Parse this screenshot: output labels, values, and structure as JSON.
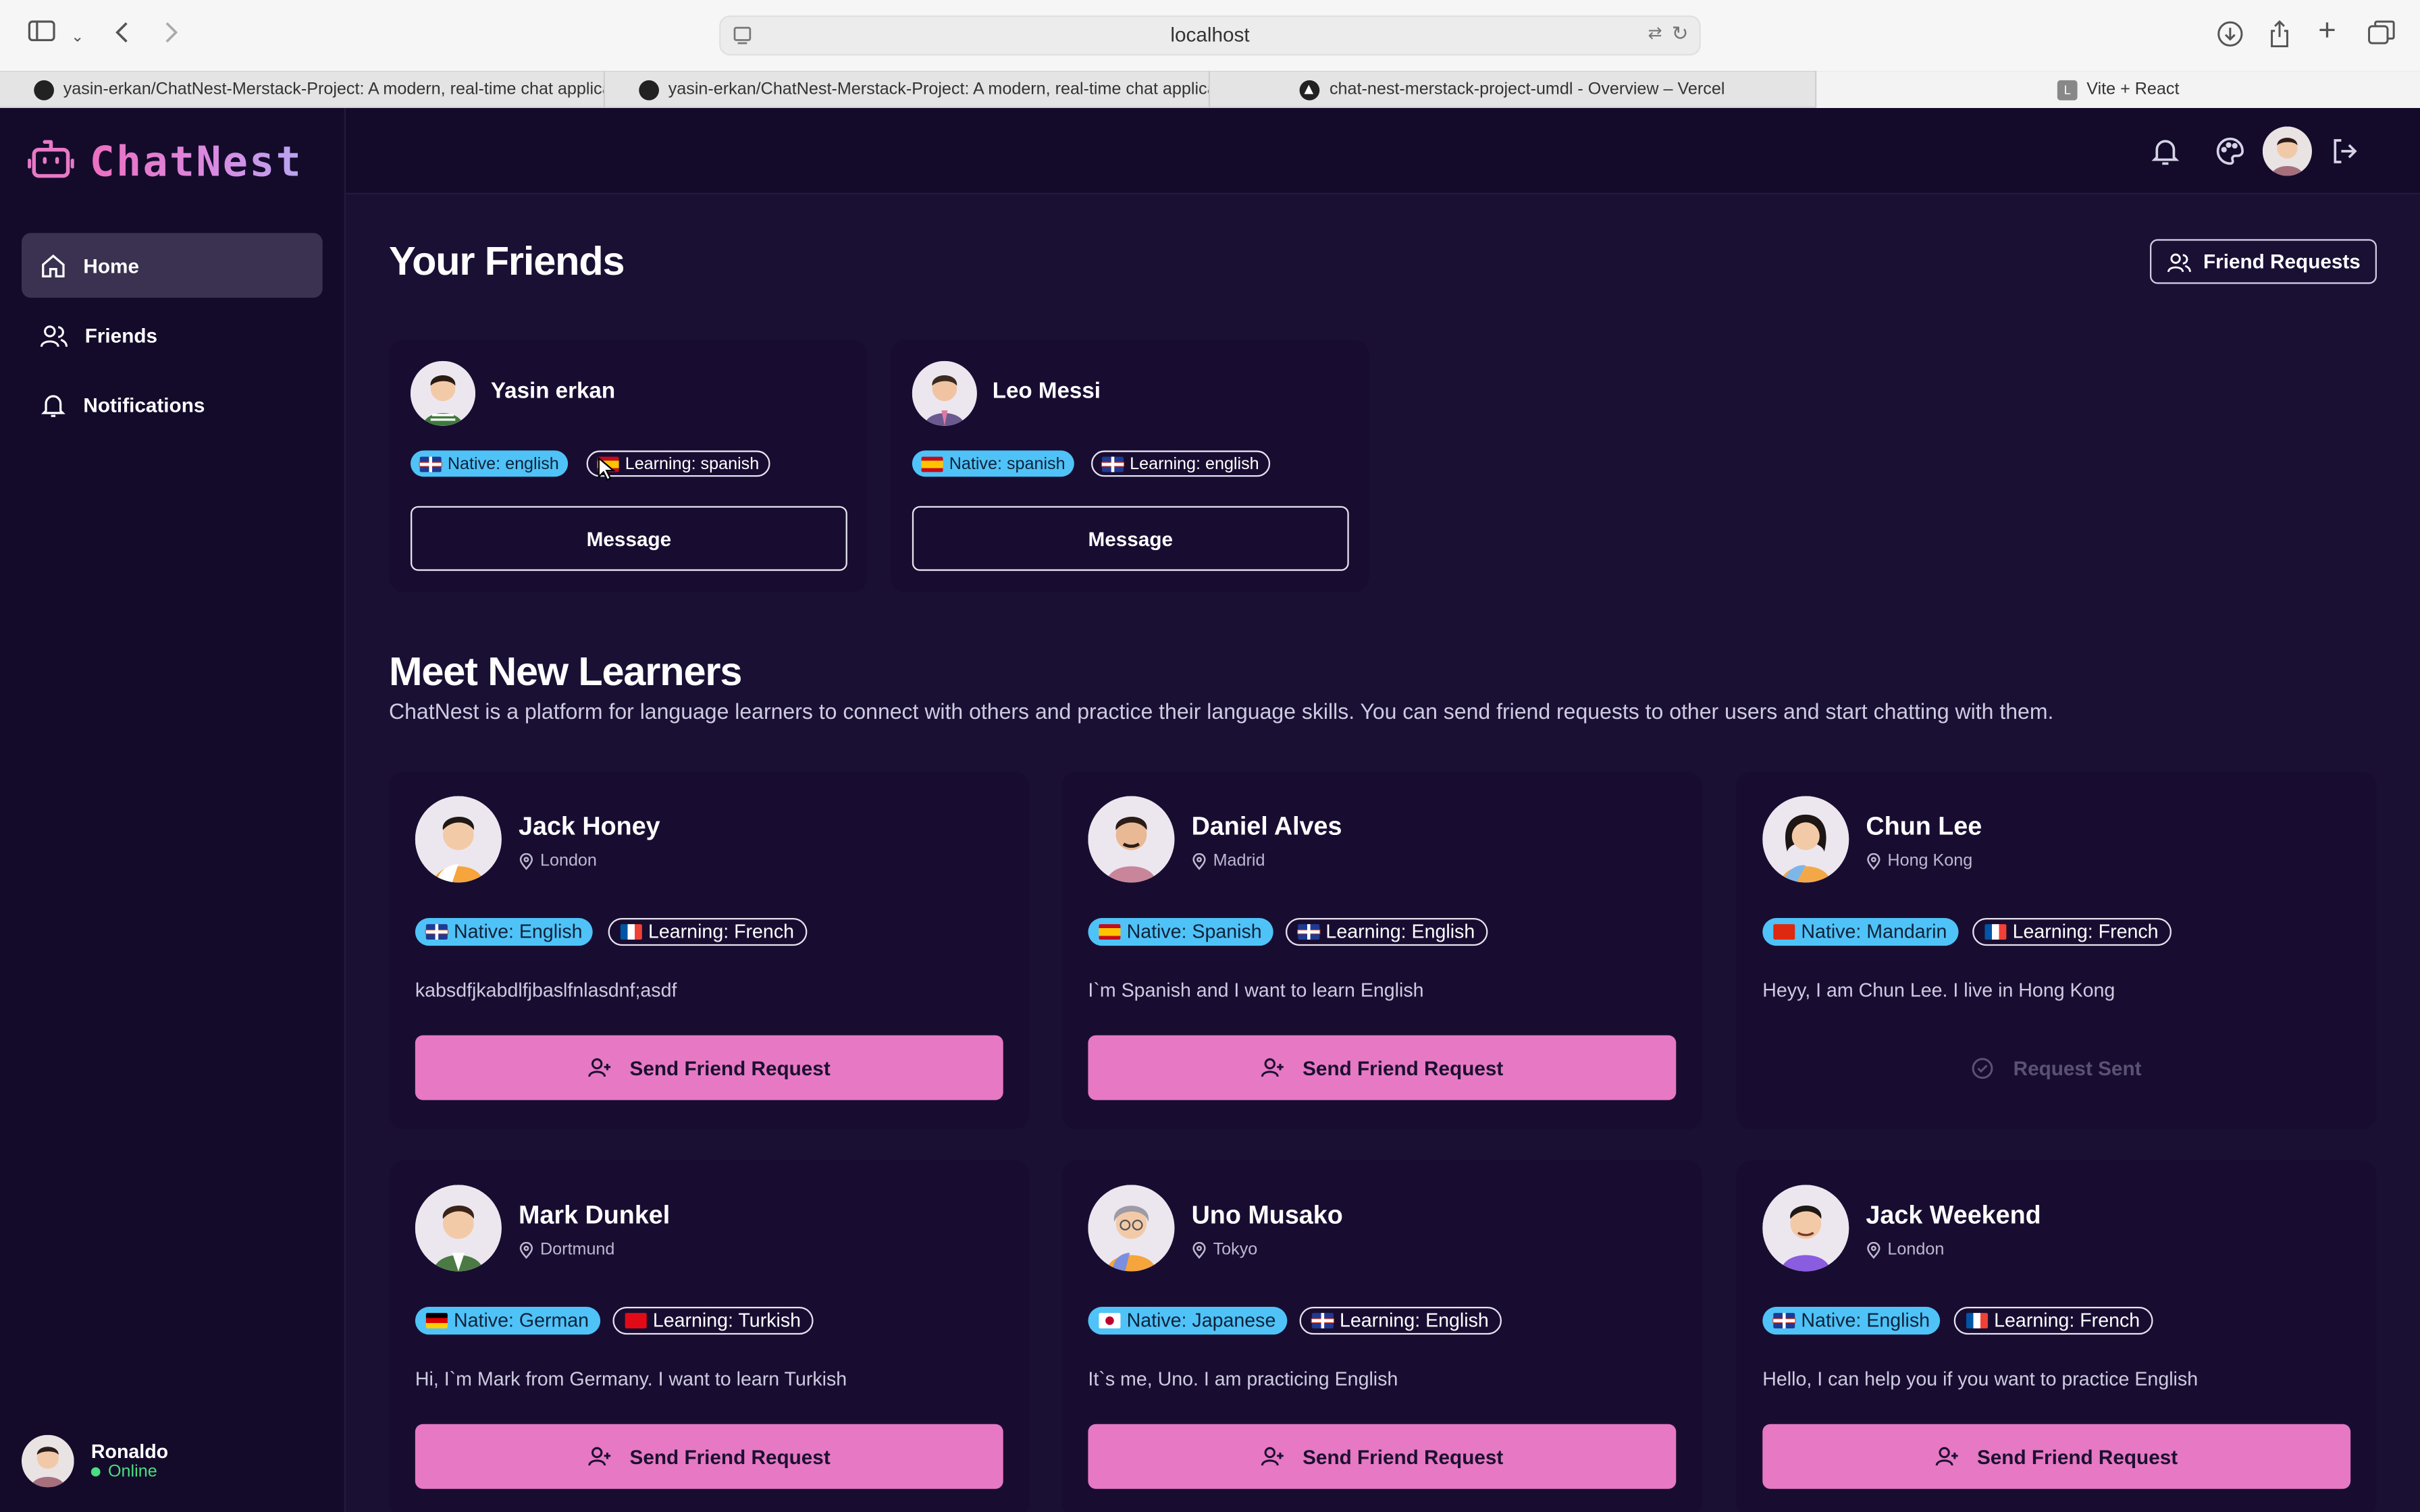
{
  "browser": {
    "url": "localhost",
    "tabs": [
      {
        "label": "yasin-erkan/ChatNest-Merstack-Project: A modern, real-time chat applicati..."
      },
      {
        "label": "yasin-erkan/ChatNest-Merstack-Project: A modern, real-time chat applicati..."
      },
      {
        "label": "chat-nest-merstack-project-umdl - Overview – Vercel"
      },
      {
        "label": "Vite + React"
      }
    ]
  },
  "app": {
    "brand": "ChatNest",
    "nav": [
      {
        "label": "Home",
        "icon": "home-icon"
      },
      {
        "label": "Friends",
        "icon": "users-icon"
      },
      {
        "label": "Notifications",
        "icon": "bell-icon"
      }
    ],
    "current_user": {
      "name": "Ronaldo",
      "status": "Online"
    }
  },
  "friends_section": {
    "title": "Your Friends",
    "requests_button": "Friend Requests",
    "friends": [
      {
        "name": "Yasin erkan",
        "native": "Native: english",
        "learning": "Learning: spanish",
        "action": "Message"
      },
      {
        "name": "Leo Messi",
        "native": "Native: spanish",
        "learning": "Learning: english",
        "action": "Message"
      }
    ]
  },
  "learners_section": {
    "title": "Meet New Learners",
    "description": "ChatNest is a platform for language learners to connect with others and practice their language skills. You can send friend requests to other users and start chatting with them.",
    "learners": [
      {
        "name": "Jack Honey",
        "location": "London",
        "native": "Native: English",
        "learning": "Learning: French",
        "bio": "kabsdfjkabdlfjbaslfnlasdnf;asdf",
        "action": "Send Friend Request"
      },
      {
        "name": "Daniel Alves",
        "location": "Madrid",
        "native": "Native: Spanish",
        "learning": "Learning: English",
        "bio": "I`m Spanish and I want to learn English",
        "action": "Send Friend Request"
      },
      {
        "name": "Chun Lee",
        "location": "Hong Kong",
        "native": "Native: Mandarin",
        "learning": "Learning: French",
        "bio": "Heyy, I am Chun Lee. I live in Hong Kong",
        "action": "Request Sent"
      },
      {
        "name": "Mark Dunkel",
        "location": "Dortmund",
        "native": "Native: German",
        "learning": "Learning: Turkish",
        "bio": "Hi, I`m Mark from Germany. I want to learn Turkish",
        "action": "Send Friend Request"
      },
      {
        "name": "Uno Musako",
        "location": "Tokyo",
        "native": "Native: Japanese",
        "learning": "Learning: English",
        "bio": "It`s me, Uno. I am practicing English",
        "action": "Send Friend Request"
      },
      {
        "name": "Jack Weekend",
        "location": "London",
        "native": "Native: English",
        "learning": "Learning: French",
        "bio": "Hello, I can help you if you want to practice English",
        "action": "Send Friend Request"
      }
    ]
  },
  "colors": {
    "accent": "#e778c4",
    "native_badge": "#4fc3f7",
    "background": "#1a1034",
    "online": "#4ade80"
  }
}
